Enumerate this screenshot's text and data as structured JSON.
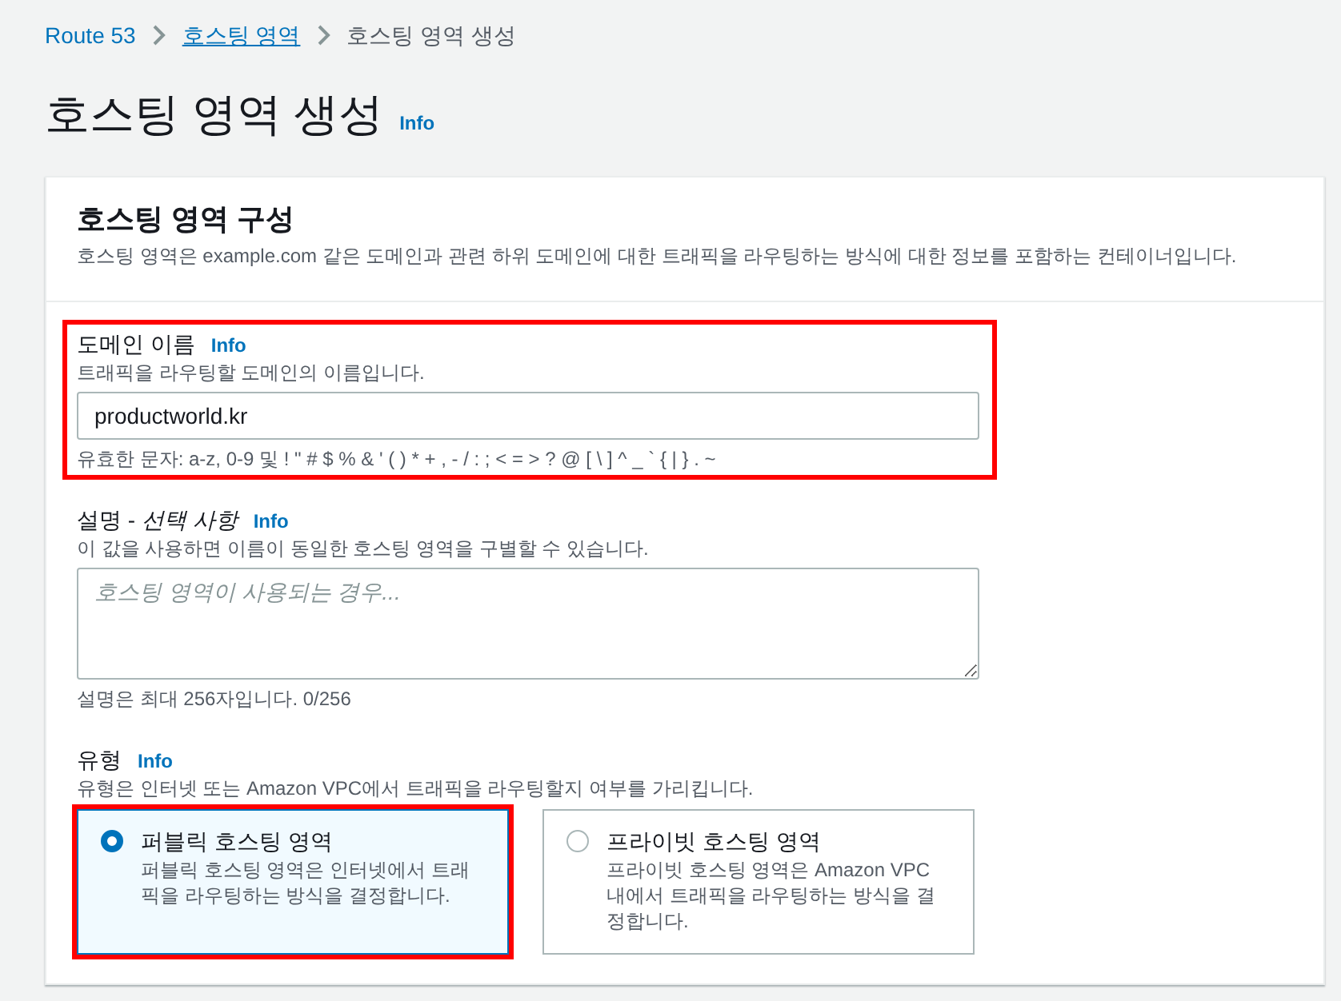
{
  "breadcrumb": [
    {
      "label": "Route 53",
      "kind": "link",
      "underlined": false
    },
    {
      "label": "호스팅 영역",
      "kind": "link",
      "underlined": true
    },
    {
      "label": "호스팅 영역 생성",
      "kind": "current",
      "underlined": false
    }
  ],
  "page": {
    "title": "호스팅 영역 생성",
    "info": "Info"
  },
  "panel": {
    "title": "호스팅 영역 구성",
    "description": "호스팅 영역은 example.com 같은 도메인과 관련 하위 도메인에 대한 트래픽을 라우팅하는 방식에 대한 정보를 포함하는 컨테이너입니다."
  },
  "fields": [
    {
      "kind": "text",
      "label": "도메인 이름",
      "info": "Info",
      "description": "트래픽을 라우팅할 도메인의 이름입니다.",
      "value": "productworld.kr",
      "constraint": "유효한 문자: a-z, 0-9 및 ! \" # $ % & ' ( ) * + , - / : ; < = > ? @ [ \\ ] ^ _ ` { | } . ~",
      "highlighted": true
    },
    {
      "kind": "textarea",
      "label": "설명 - *선택 사항*",
      "info": "Info",
      "description": "이 값을 사용하면 이름이 동일한 호스팅 영역을 구별할 수 있습니다.",
      "placeholder": "호스팅 영역이 사용되는 경우...",
      "constraint": "설명은 최대 256자입니다. 0/256",
      "highlighted": false
    },
    {
      "kind": "radio-tiles",
      "label": "유형",
      "info": "Info",
      "description": "유형은 인터넷 또는 Amazon VPC에서 트래픽을 라우팅할지 여부를 가리킵니다.",
      "highlighted": false,
      "options": [
        {
          "title": "퍼블릭 호스팅 영역",
          "description": "퍼블릭 호스팅 영역은 인터넷에서 트래픽을 라우팅하는 방식을 결정합니다.",
          "selected": true,
          "highlighted": true
        },
        {
          "title": "프라이빗 호스팅 영역",
          "description": "프라이빗 호스팅 영역은 Amazon VPC 내에서 트래픽을 라우팅하는 방식을 결정합니다.",
          "selected": false,
          "highlighted": false
        }
      ]
    }
  ]
}
